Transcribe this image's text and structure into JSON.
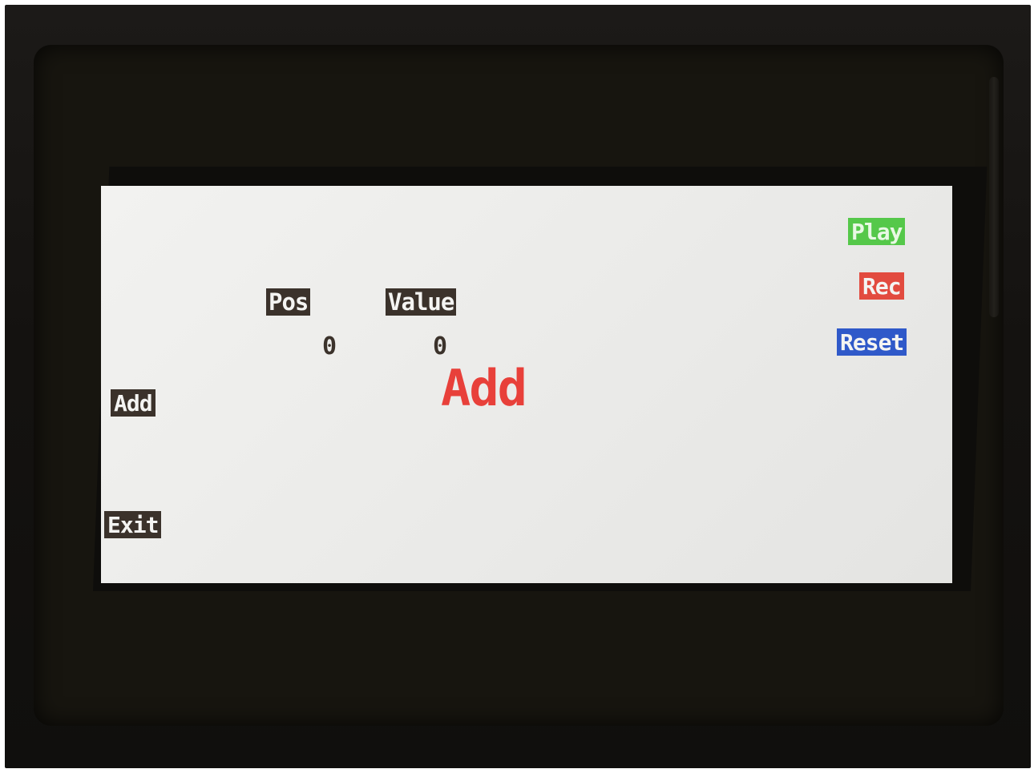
{
  "screen": {
    "labels": {
      "pos": "Pos",
      "value": "Value"
    },
    "values": {
      "pos": "0",
      "value": "0"
    },
    "title": "Add",
    "title_color": "#e8403a"
  },
  "left_buttons": {
    "add": "Add",
    "exit": "Exit"
  },
  "right_buttons": {
    "play": "Play",
    "rec": "Rec",
    "reset": "Reset",
    "play_color": "#55c84a",
    "rec_color": "#e24b3f",
    "reset_color": "#2f59c9"
  },
  "colors": {
    "lcd_background": "#eeeeec",
    "label_background": "#3b322b",
    "bezel": "#141210"
  }
}
